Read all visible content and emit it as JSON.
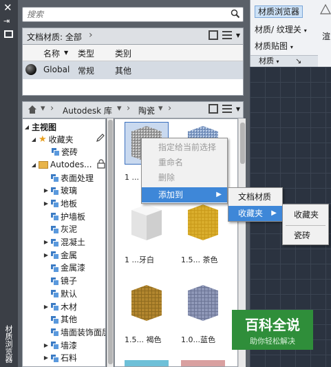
{
  "left_strip": {
    "close": "✕",
    "pin": "⇥",
    "vertical_label": "材质浏览器"
  },
  "search": {
    "placeholder": "搜索"
  },
  "doc_materials": {
    "label": "文档材质: 全部"
  },
  "table": {
    "headers": [
      "名称",
      "类型",
      "类别"
    ],
    "rows": [
      {
        "name": "Global",
        "type": "常规",
        "category": "其他"
      }
    ]
  },
  "library_bar": {
    "lib": "Autodesk 库",
    "cat": "陶瓷"
  },
  "tree": {
    "root": "主视图",
    "favorites": "收藏夹",
    "fav_child": "瓷砖",
    "autodesk": "Autodes...",
    "items": [
      "表面处理",
      "玻璃",
      "地板",
      "护墙板",
      "灰泥",
      "混凝土",
      "金属",
      "金属漆",
      "镜子",
      "默认",
      "木材",
      "其他",
      "墙面装饰面层",
      "墙漆",
      "石料"
    ]
  },
  "grid": {
    "captions": [
      "1 ...",
      "",
      "1 ...牙白",
      "1.5... 茶色",
      "1.5... 褐色",
      "1.0...蓝色"
    ]
  },
  "context_menu": {
    "items": [
      "指定给当前选择",
      "重命名",
      "删除",
      "添加到"
    ],
    "sub1": [
      "文档材质",
      "收藏夹"
    ],
    "sub2": [
      "收藏夹",
      "瓷砖"
    ]
  },
  "ribbon": {
    "material_browser": "材质浏览器",
    "material_texture": "材质/ 纹理关",
    "material_map": "材质贴图",
    "group": "材质",
    "render": "渲"
  },
  "watermark": {
    "title": "百科全说",
    "subtitle": "助你轻松解决"
  }
}
